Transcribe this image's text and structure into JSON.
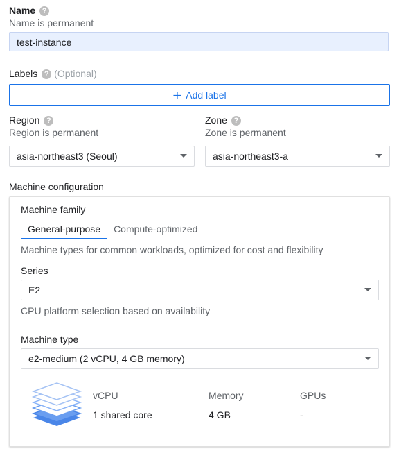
{
  "name": {
    "label": "Name",
    "help": "?",
    "hint": "Name is permanent",
    "value": "test-instance"
  },
  "labels": {
    "label": "Labels",
    "help": "?",
    "optional": "(Optional)",
    "add_button": "Add label",
    "add_icon": "plus-icon"
  },
  "region": {
    "label": "Region",
    "help": "?",
    "hint": "Region is permanent",
    "value": "asia-northeast3 (Seoul)"
  },
  "zone": {
    "label": "Zone",
    "help": "?",
    "hint": "Zone is permanent",
    "value": "asia-northeast3-a"
  },
  "machine_configuration": {
    "heading": "Machine configuration",
    "family_label": "Machine family",
    "tabs": [
      {
        "label": "General-purpose",
        "active": true
      },
      {
        "label": "Compute-optimized",
        "active": false
      }
    ],
    "family_description": "Machine types for common workloads, optimized for cost and flexibility",
    "series_label": "Series",
    "series_value": "E2",
    "series_hint": "CPU platform selection based on availability",
    "machine_type_label": "Machine type",
    "machine_type_value": "e2-medium (2 vCPU, 4 GB memory)",
    "icon": "stacked-layers-icon",
    "stats": [
      {
        "header": "vCPU",
        "value": "1 shared core"
      },
      {
        "header": "Memory",
        "value": "4 GB"
      },
      {
        "header": "GPUs",
        "value": "-"
      }
    ]
  },
  "colors": {
    "accent": "#1a73e8",
    "input_bg": "#e8f0fe",
    "layer_blue": "#4a86e8"
  }
}
